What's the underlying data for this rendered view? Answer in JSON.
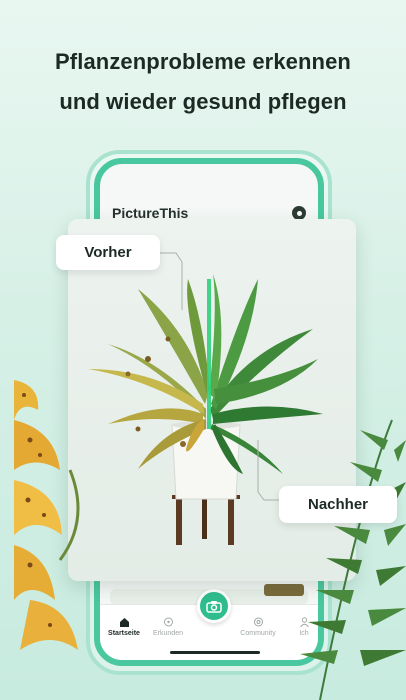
{
  "headline": {
    "line1": "Pflanzenprobleme erkennen",
    "line2": "und wieder gesund pflegen"
  },
  "app": {
    "brand": "PictureThis",
    "tabs": [
      {
        "label": "Startseite",
        "icon": "home-icon",
        "active": true
      },
      {
        "label": "Erkunden",
        "icon": "compass-icon",
        "active": false
      },
      {
        "label": "",
        "icon": "camera-icon",
        "active": false
      },
      {
        "label": "Community",
        "icon": "community-icon",
        "active": false
      },
      {
        "label": "Ich",
        "icon": "profile-icon",
        "active": false
      }
    ]
  },
  "comparison": {
    "before_label": "Vorher",
    "after_label": "Nachher",
    "divider_color": "#2fd07d"
  },
  "colors": {
    "accent": "#2fbd8e",
    "phone_frame": "#49c79e",
    "text_dark": "#1d2a24"
  }
}
